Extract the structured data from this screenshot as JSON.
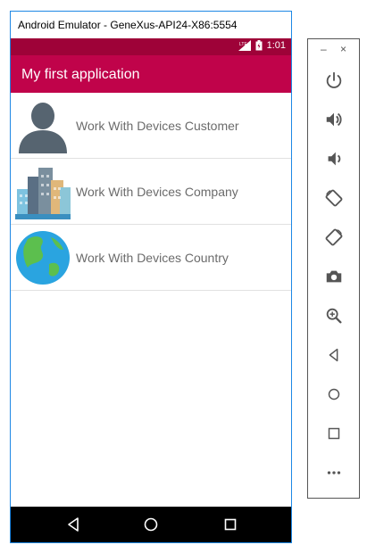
{
  "window": {
    "title": "Android Emulator - GeneXus-API24-X86:5554"
  },
  "status_bar": {
    "network": "LTE",
    "time": "1:01"
  },
  "app_bar": {
    "title": "My first application"
  },
  "items": [
    {
      "label": "Work With Devices Customer",
      "icon": "person-icon"
    },
    {
      "label": "Work With Devices Company",
      "icon": "buildings-icon"
    },
    {
      "label": "Work With Devices Country",
      "icon": "globe-icon"
    }
  ],
  "nav_bar": {
    "buttons": [
      "back-icon",
      "home-icon",
      "recents-icon"
    ]
  },
  "side_panel": {
    "controls": [
      "–",
      "×"
    ],
    "buttons": [
      "power-icon",
      "volume-up-icon",
      "volume-down-icon",
      "rotate-left-icon",
      "rotate-right-icon",
      "camera-icon",
      "zoom-icon",
      "back-icon",
      "home-icon",
      "overview-icon",
      "more-icon"
    ]
  },
  "colors": {
    "status_bar": "#9e0238",
    "app_bar": "#c0034a",
    "text_secondary": "#6b6b6b",
    "icon_gray": "#555555"
  }
}
